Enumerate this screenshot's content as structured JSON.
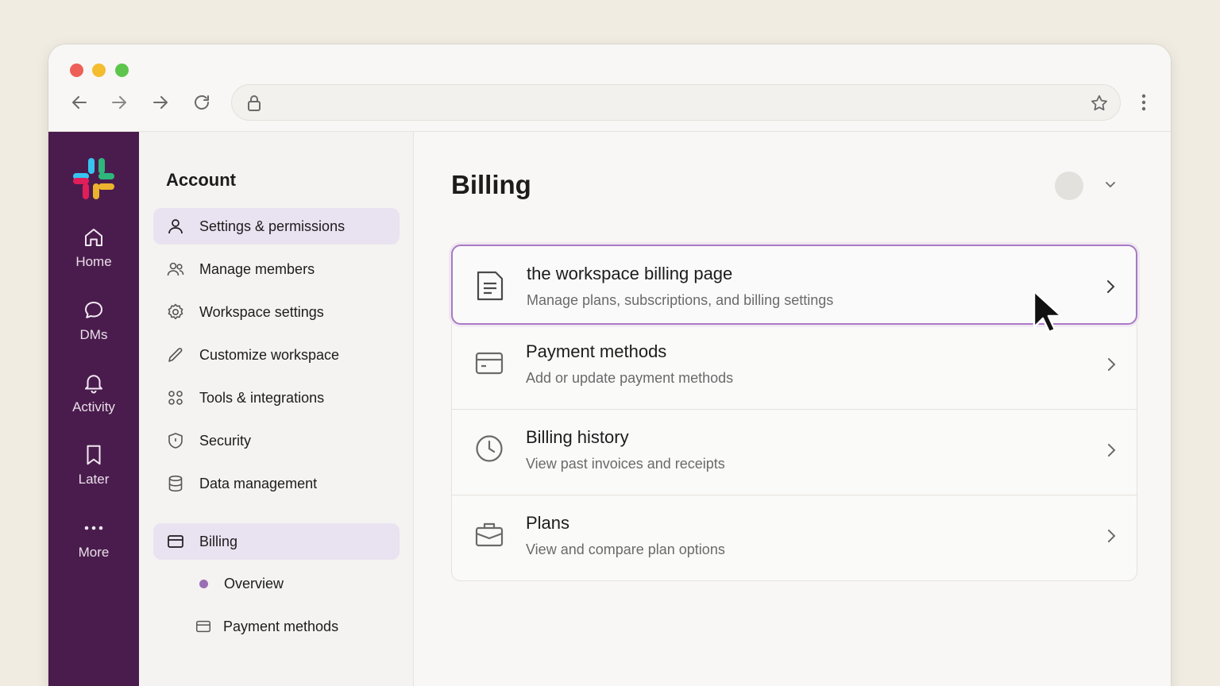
{
  "browser": {
    "url_value": "",
    "url_placeholder": ""
  },
  "rail": {
    "items": [
      {
        "label": "Home",
        "icon": "home-icon"
      },
      {
        "label": "DMs",
        "icon": "chat-bubble-icon"
      },
      {
        "label": "Activity",
        "icon": "bell-icon"
      },
      {
        "label": "Later",
        "icon": "bookmark-icon"
      },
      {
        "label": "More",
        "icon": "more-dots-icon"
      }
    ]
  },
  "sidebar": {
    "title": "Account",
    "items": [
      {
        "label": "Settings & permissions",
        "icon": "person-icon",
        "active": true
      },
      {
        "label": "Manage members",
        "icon": "people-icon"
      },
      {
        "label": "Workspace settings",
        "icon": "gear-icon"
      },
      {
        "label": "Customize workspace",
        "icon": "pencil-icon"
      },
      {
        "label": "Tools & integrations",
        "icon": "grid-dots-icon"
      },
      {
        "label": "Security",
        "icon": "shield-icon"
      },
      {
        "label": "Data management",
        "icon": "database-icon"
      },
      {
        "label": "Billing",
        "icon": "card-icon",
        "active": true
      }
    ],
    "subitems": [
      {
        "label": "Overview",
        "icon": "bullet-dot-icon"
      },
      {
        "label": "Payment methods",
        "icon": "card-icon"
      }
    ]
  },
  "main": {
    "title": "Billing",
    "cards": [
      {
        "title": "the workspace billing page",
        "desc": "Manage plans, subscriptions, and billing settings",
        "icon": "document-icon"
      },
      {
        "title": "Payment methods",
        "desc": "Add or update payment methods",
        "icon": "card-icon"
      },
      {
        "title": "Billing history",
        "desc": "View past invoices and receipts",
        "icon": "clock-icon"
      },
      {
        "title": "Plans",
        "desc": "View and compare plan options",
        "icon": "briefcase-icon"
      }
    ]
  },
  "colors": {
    "rail_bg": "#4a1c4d",
    "active_bg": "#e9e2f0",
    "highlight_border": "#a979c5",
    "bullet": "#9b6fb3"
  }
}
